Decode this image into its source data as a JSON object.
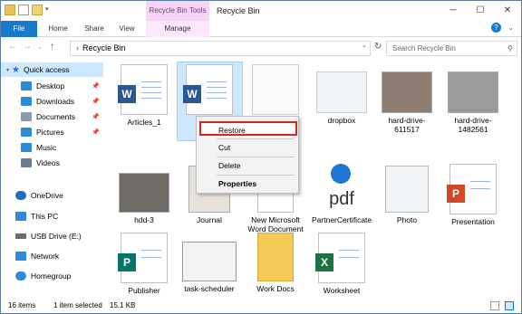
{
  "window": {
    "title": "Recycle Bin",
    "contextual_tab_group": "Recycle Bin Tools",
    "controls": [
      "─",
      "☐",
      "✕"
    ]
  },
  "ribbon": {
    "tabs": [
      "File",
      "Home",
      "Share",
      "View",
      "Manage"
    ]
  },
  "address": {
    "path": "Recycle Bin",
    "search_placeholder": "Search Recycle Bin"
  },
  "sidebar": {
    "items": [
      {
        "label": "Quick access",
        "icon": "star-icon",
        "color": "#1e6fbf"
      },
      {
        "label": "Desktop",
        "icon": "desktop-icon",
        "color": "#2e89d6",
        "pinned": true
      },
      {
        "label": "Downloads",
        "icon": "download-icon",
        "color": "#2e89d6",
        "pinned": true
      },
      {
        "label": "Documents",
        "icon": "documents-icon",
        "color": "#8a9bb0",
        "pinned": true
      },
      {
        "label": "Pictures",
        "icon": "pictures-icon",
        "color": "#2e89d6",
        "pinned": true
      },
      {
        "label": "Music",
        "icon": "music-icon",
        "color": "#2e89d6"
      },
      {
        "label": "Videos",
        "icon": "videos-icon",
        "color": "#6a7d8f"
      },
      {
        "label": "OneDrive",
        "icon": "cloud-icon",
        "color": "#1e6fbf"
      },
      {
        "label": "This PC",
        "icon": "computer-icon",
        "color": "#2e89d6"
      },
      {
        "label": "USB Drive (E:)",
        "icon": "usb-drive-icon",
        "color": "#6a6a6a"
      },
      {
        "label": "Network",
        "icon": "network-icon",
        "color": "#2e89d6"
      },
      {
        "label": "Homegroup",
        "icon": "homegroup-icon",
        "color": "#2e89d6"
      }
    ]
  },
  "files": [
    {
      "name": "Articles_1",
      "type": "word"
    },
    {
      "name": "",
      "type": "word"
    },
    {
      "name": "",
      "type": "blank"
    },
    {
      "name": "dropbox",
      "type": "image"
    },
    {
      "name": "hard-drive-611517",
      "type": "image"
    },
    {
      "name": "hard-drive-1482561",
      "type": "image"
    },
    {
      "name": "hdd-3",
      "type": "image"
    },
    {
      "name": "Journal",
      "type": "image"
    },
    {
      "name": "New Microsoft Word Document",
      "type": "blank"
    },
    {
      "name": "PartnerCertificate",
      "type": "pdf"
    },
    {
      "name": "Photo",
      "type": "image"
    },
    {
      "name": "Presentation",
      "type": "ppt"
    },
    {
      "name": "Publisher",
      "type": "pub"
    },
    {
      "name": "task-scheduler",
      "type": "image"
    },
    {
      "name": "Work Docs",
      "type": "folder"
    },
    {
      "name": "Worksheet",
      "type": "xls"
    }
  ],
  "context_menu": {
    "items": [
      "Restore",
      "Cut",
      "Delete",
      "Properties"
    ]
  },
  "status": {
    "count": "16 items",
    "selection": "1 item selected",
    "size": "15.1 KB"
  },
  "colors": {
    "accent": "#1979ca",
    "highlight": "#d9261c",
    "selection": "#cde8ff"
  }
}
